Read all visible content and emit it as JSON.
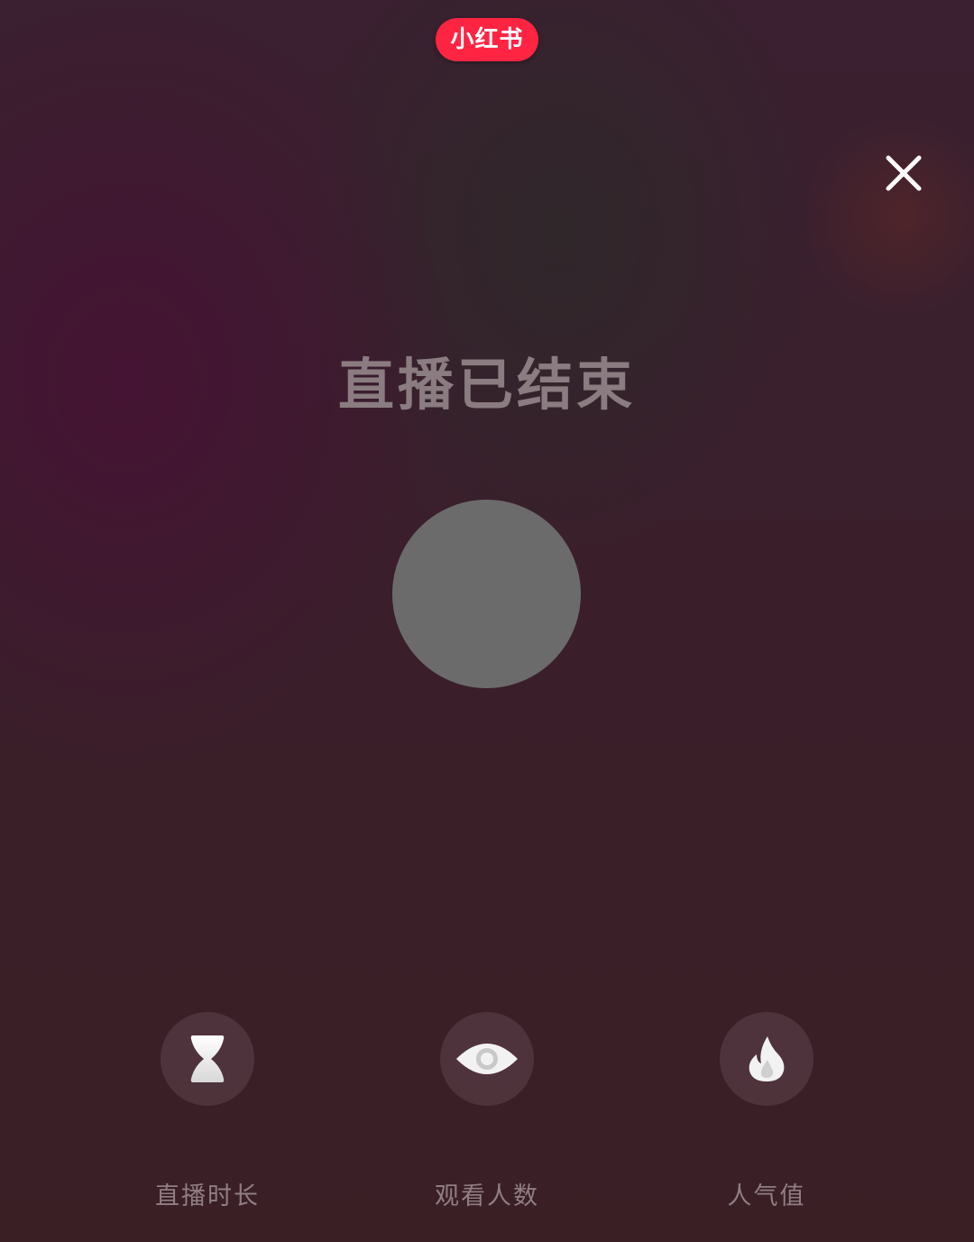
{
  "header": {
    "app_logo_text": "小红书",
    "close_icon": "close-icon"
  },
  "main": {
    "title": "直播已结束",
    "avatar": "avatar-placeholder"
  },
  "stats": [
    {
      "icon": "hourglass-icon",
      "label": "直播时长"
    },
    {
      "icon": "eye-icon",
      "label": "观看人数"
    },
    {
      "icon": "flame-icon",
      "label": "人气值"
    }
  ],
  "colors": {
    "brand_red": "#ff2442",
    "title_text": "#8a7c80",
    "label_text": "#8f7f84",
    "avatar_gray": "#6c6b6c"
  }
}
